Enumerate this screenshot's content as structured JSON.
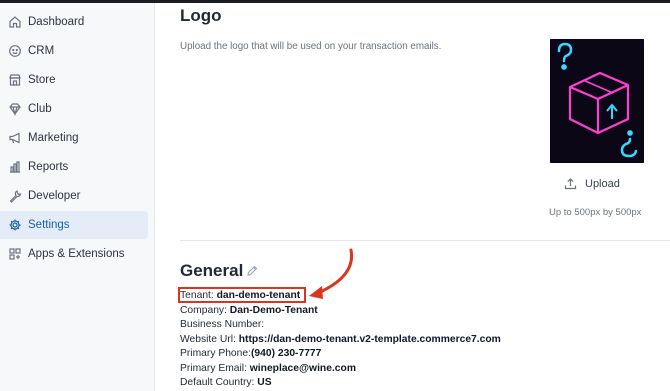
{
  "sidebar": {
    "items": [
      {
        "label": "Dashboard",
        "icon": "home-icon"
      },
      {
        "label": "CRM",
        "icon": "smiley-icon"
      },
      {
        "label": "Store",
        "icon": "store-icon"
      },
      {
        "label": "Club",
        "icon": "diamond-icon"
      },
      {
        "label": "Marketing",
        "icon": "megaphone-icon"
      },
      {
        "label": "Reports",
        "icon": "bar-chart-icon"
      },
      {
        "label": "Developer",
        "icon": "wrench-icon"
      },
      {
        "label": "Settings",
        "icon": "gear-icon",
        "active": true
      },
      {
        "label": "Apps & Extensions",
        "icon": "apps-icon"
      }
    ]
  },
  "logo_section": {
    "title": "Logo",
    "description": "Upload the logo that will be used on your transaction emails.",
    "upload_label": "Upload",
    "upload_hint": "Up to 500px by 500px"
  },
  "general": {
    "title": "General",
    "fields": [
      {
        "key": "Tenant: ",
        "value": "dan-demo-tenant"
      },
      {
        "key": "Company: ",
        "value": "Dan-Demo-Tenant"
      },
      {
        "key": "Business Number:",
        "value": ""
      },
      {
        "key": "Website Url: ",
        "value": "https://dan-demo-tenant.v2-template.commerce7.com"
      },
      {
        "key": "Primary Phone:",
        "value": "(940) 230-7777"
      },
      {
        "key": "Primary Email: ",
        "value": "wineplace@wine.com"
      },
      {
        "key": "Default Country: ",
        "value": "US"
      }
    ]
  },
  "colors": {
    "active_bg": "#e3ecf7",
    "active_text": "#1f5fa8",
    "annotation": "#d9371c",
    "neon_pink": "#ff3fd0",
    "neon_blue": "#38d9ff"
  }
}
